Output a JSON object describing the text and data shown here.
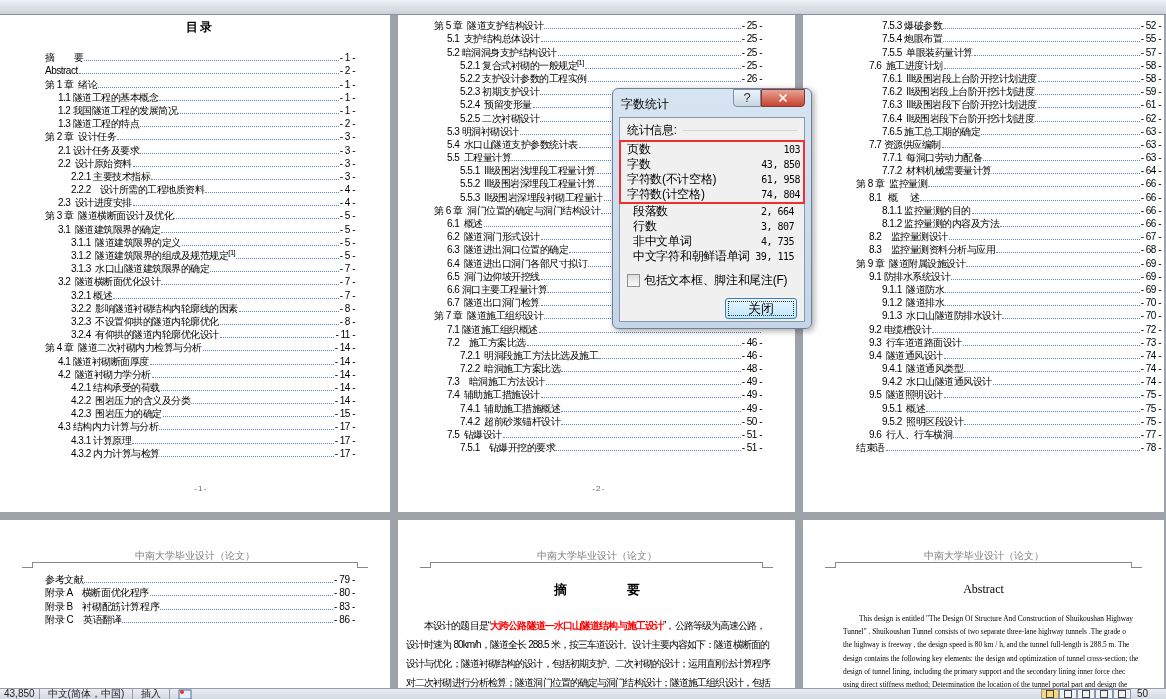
{
  "pages_top": [
    {
      "kind": "toc",
      "title": "目录",
      "footer": "- 1 -",
      "entries": [
        {
          "title": "摘　　要",
          "page": "- 1 -"
        },
        {
          "title": "Abstract",
          "page": "- 2 -"
        },
        {
          "title": "第 1 章  绪论",
          "page": "- 1 -",
          "children": [
            {
              "title": "1.1 隧道工程的基本概念",
              "page": "- 1 -"
            },
            {
              "title": "1.2 我国隧道工程的发展简况",
              "page": "- 1 -"
            },
            {
              "title": "1.3 隧道工程的特点",
              "page": "- 2 -"
            }
          ]
        },
        {
          "title": "第 2 章  设计任务",
          "page": "- 3 -",
          "children": [
            {
              "title": "2.1 设计任务及要求",
              "page": "- 3 -"
            },
            {
              "title": "2.2  设计原始资料",
              "page": "- 3 -",
              "children": [
                {
                  "title": "2.2.1 主要技术指标",
                  "page": "- 3 -"
                },
                {
                  "title": "2.2.2    设计所需的工程地质资料",
                  "page": "- 4 -"
                }
              ]
            },
            {
              "title": "2.3  设计进度安排",
              "page": "- 4 -"
            }
          ]
        },
        {
          "title": "第 3 章  隧道横断面设计及优化",
          "page": "- 5 -",
          "children": [
            {
              "title": "3.1  隧道建筑限界的确定",
              "page": "- 5 -",
              "children": [
                {
                  "title": "3.1.1  隧道建筑限界的定义",
                  "page": "- 5 -"
                },
                {
                  "title": "3.1.2  隧道建筑限界的组成及规范规定$^{[1]}$",
                  "page": "- 5 -"
                },
                {
                  "title": "3.1.3  水口山隧道建筑限界的确定",
                  "page": "- 7 -"
                }
              ]
            },
            {
              "title": "3.2  隧道横断面优化设计",
              "page": "- 7 -",
              "children": [
                {
                  "title": "3.2.1 概述",
                  "page": "- 7 -"
                },
                {
                  "title": "3.2.2  影响隧道衬砌结构内轮廓线的因素",
                  "page": "- 8 -"
                },
                {
                  "title": "3.2.3  不设置仰拱的隧道内轮廓优化",
                  "page": "- 8 -"
                },
                {
                  "title": "3.2.4  有仰拱的隧道内轮廓优化设计",
                  "page": "- 11 -"
                }
              ]
            }
          ]
        },
        {
          "title": "第 4 章  隧道二次衬砌内力检算与分析",
          "page": "- 14 -",
          "children": [
            {
              "title": "4.1 隧道衬砌断面厚度",
              "page": "- 14 -"
            },
            {
              "title": "4.2  隧道衬砌力学分析",
              "page": "- 14 -",
              "children": [
                {
                  "title": "4.2.1 结构承受的荷载",
                  "page": "- 14 -"
                },
                {
                  "title": "4.2.2  围岩压力的含义及分类",
                  "page": "- 14 -"
                },
                {
                  "title": "4.2.3  围岩压力的确定",
                  "page": "- 15 -"
                }
              ]
            },
            {
              "title": "4.3 结构内力计算与分析",
              "page": "- 17 -",
              "children": [
                {
                  "title": "4.3.1 计算原理",
                  "page": "- 17 -"
                },
                {
                  "title": "4.3.2 内力计算与检算",
                  "page": "- 17 -"
                }
              ]
            }
          ]
        }
      ]
    },
    {
      "kind": "toc",
      "footer": "- 2 -",
      "entries": [
        {
          "title": "第 5 章  隧道支护结构设计",
          "page": "- 25 -",
          "children": [
            {
              "title": "5.1  支护结构总体设计",
              "page": "- 25 -"
            },
            {
              "title": "5.2 暗洞洞身支护结构设计",
              "page": "- 25 -",
              "children": [
                {
                  "title": "5.2.1 复合式衬砌的一般规定$^{[1]}$",
                  "page": "- 25 -"
                },
                {
                  "title": "5.2.2 支护设计参数的工程实例",
                  "page": "- 26 -"
                },
                {
                  "title": "5.2.3 初期支护设计"
                },
                {
                  "title": "5.2.4  预留变形量"
                },
                {
                  "title": "5.2.5 二次衬砌设计"
                }
              ]
            },
            {
              "title": "5.3 明洞衬砌设计"
            },
            {
              "title": "5.4  水口山隧道支护参数统计表"
            },
            {
              "title": "5.5  工程量计算",
              "children": [
                {
                  "title": "5.5.1  III级围岩浅埋段工程量计算"
                },
                {
                  "title": "5.5.2  III级围岩深埋段工程量计算"
                },
                {
                  "title": "5.5.3  II级围岩深埋段衬砌工程量计"
                }
              ]
            }
          ]
        },
        {
          "title": "第 6 章  洞门位置的确定与洞门结构设计",
          "children": [
            {
              "title": "6.1  概述"
            },
            {
              "title": "6.2  隧道洞门形式设计"
            },
            {
              "title": "6.3  隧道进出洞口位置的确定"
            },
            {
              "title": "6.4  隧道进出口洞门各部尺寸拟订"
            },
            {
              "title": "6.5  洞门边仰坡开挖线"
            },
            {
              "title": "6.6 洞口主要工程量计算"
            },
            {
              "title": "6.7  隧道出口洞门检算"
            }
          ]
        },
        {
          "title": "第 7 章  隧道施工组织设计",
          "children": [
            {
              "title": "7.1 隧道施工组织概述"
            },
            {
              "title": "7.2    施工方案比选",
              "page": "- 46 -",
              "children": [
                {
                  "title": "7.2.1  明洞段施工方法比选及施工",
                  "page": "- 46 -"
                },
                {
                  "title": "7.2.2  暗洞施工方案比选",
                  "page": "- 48 -"
                }
              ]
            },
            {
              "title": "7.3    暗洞施工方法设计",
              "page": "- 49 -"
            },
            {
              "title": "7.4  辅助施工措施设计",
              "page": "- 49 -",
              "children": [
                {
                  "title": "7.4.1  辅助施工措施概述",
                  "page": "- 49 -"
                },
                {
                  "title": "7.4.2  超前砂浆锚杆设计",
                  "page": "- 50 -"
                }
              ]
            },
            {
              "title": "7.5  钻爆设计",
              "page": "- 51 -",
              "children": [
                {
                  "title": "7.5.1    钻爆开挖的要求",
                  "page": "- 51 -"
                }
              ]
            }
          ]
        }
      ]
    },
    {
      "kind": "toc",
      "entries": [
        {
          "children": [
            {
              "children": [
                {
                  "title": "7.5.3 爆破参数",
                  "page": "- 52 -"
                },
                {
                  "title": "7.5.4 炮眼布置",
                  "page": "- 55 -"
                },
                {
                  "title": "7.5.5  单眼装药量计算",
                  "page": "- 57 -"
                }
              ]
            },
            {
              "title": "7.6  施工进度计划",
              "page": "- 58 -",
              "children": [
                {
                  "title": "7.6.1  III级围岩段上台阶开挖计划进度",
                  "page": "- 58 -"
                },
                {
                  "title": "7.6.2  II级围岩段上台阶开挖计划进度",
                  "page": "- 59 -"
                },
                {
                  "title": "7.6.3  III级围岩段下台阶开挖计划进度",
                  "page": "- 61 -"
                },
                {
                  "title": "7.6.4  II级围岩段下台阶开挖计划进度",
                  "page": "- 62 -"
                },
                {
                  "title": "7.6.5 施工总工期的确定",
                  "page": "- 63 -"
                }
              ]
            },
            {
              "title": "7.7 资源供应编制",
              "page": "- 63 -",
              "children": [
                {
                  "title": "7.7.1  每洞口劳动力配备",
                  "page": "- 63 -"
                },
                {
                  "title": "7.7.2  材料机械需要量计算",
                  "page": "- 64 -"
                }
              ]
            }
          ]
        },
        {
          "title": "第 8 章  监控量测",
          "page": "- 66 -",
          "children": [
            {
              "title": "8.1   概　 述",
              "page": "- 66 -",
              "children": [
                {
                  "title": "8.1.1 监控量测的目的",
                  "page": "- 66 -"
                },
                {
                  "title": "8.1.2 监控量测的内容及方法",
                  "page": "- 66 -"
                }
              ]
            },
            {
              "title": "8.2    监控量测设计",
              "page": "- 67 -"
            },
            {
              "title": "8.3    监控量测资料分析与应用",
              "page": "- 68 -"
            }
          ]
        },
        {
          "title": "第 9 章  隧道附属设施设计",
          "page": "- 69 -",
          "children": [
            {
              "title": "9.1 防排水系统设计",
              "page": "- 69 -",
              "children": [
                {
                  "title": "9.1.1  隧道防水",
                  "page": "- 69 -"
                },
                {
                  "title": "9.1.2  隧道排水",
                  "page": "- 70 -"
                },
                {
                  "title": "9.1.3  水口山隧道防排水设计",
                  "page": "- 70 -"
                }
              ]
            },
            {
              "title": "9.2 电缆槽设计",
              "page": "- 72 -"
            },
            {
              "title": "9.3  行车道道路面设计",
              "page": "- 73 -"
            },
            {
              "title": "9.4  隧道通风设计",
              "page": "- 74 -",
              "children": [
                {
                  "title": "9.4.1  隧道通风类型",
                  "page": "- 74 -"
                },
                {
                  "title": "9.4.2  水口山隧道通风设计",
                  "page": "- 74 -"
                }
              ]
            },
            {
              "title": "9.5  隧道照明设计",
              "page": "- 75 -",
              "children": [
                {
                  "title": "9.5.1  概述",
                  "page": "- 75 -"
                },
                {
                  "title": "9.5.2  照明区段设计",
                  "page": "- 75 -"
                }
              ]
            },
            {
              "title": "9.6  行人、行车横洞",
              "page": "- 77 -"
            }
          ]
        },
        {
          "title": "结束语",
          "page": "- 78 -"
        }
      ]
    }
  ],
  "pages_bottom": [
    {
      "kind": "toc",
      "header": "中南大学毕业设计（论文）",
      "entries": [
        {
          "title": "参考文献",
          "page": "- 79 -"
        },
        {
          "title": "附录 A    横断面优化程序",
          "page": "- 80 -"
        },
        {
          "title": "附录 B    衬砌配筋计算程序",
          "page": "- 83 -"
        },
        {
          "title": "附录 C    英语翻译",
          "page": "- 86 -"
        }
      ]
    },
    {
      "kind": "chinese_text",
      "header": "中南大学毕业设计（论文）",
      "title": "摘 要",
      "lines": [
        "本设计的题目是“**大跨公路隧道—水口山隧道结构与施工设计**”，公路等级为高速公路，",
        "设计时速为 80km/h，隧道全长 288.5 米，按三车道设计。设计主要内容如下：隧道横断面的",
        "设计与优化；隧道衬砌结构的设计，包括初期支护、二次衬砌的设计；运用直刚法计算程序",
        "对二次衬砌进行分析检算；隧道洞门位置的确定与洞门结构设计；隧道施工组织设计，包括"
      ]
    },
    {
      "kind": "english_text",
      "header": "中南大学毕业设计（论文）",
      "title": "Abstract",
      "lines": [
        "This design is entitled \"The Design Of Structure And Construction of Shuikoushan Highway",
        "Tunnel\" . Shuikoushan Tunnel consists of two separate three-lane highway tunnels .The grade o",
        "the highway is freeway , the design speed is 80 km / h, and the tunnel full-length is 288.5 m. The",
        "design contains the following key elements: the design and optimization of tunnel cross-section; the",
        "design of tunnel lining, including the primary support and the secondary lining inner force chec",
        "using direct stiffness method; Determination the location of the tunnel portal part and design the"
      ]
    }
  ],
  "dialog": {
    "title": "字数统计",
    "help_button": "?",
    "group_label": "统计信息:",
    "stats": [
      {
        "label": "页数",
        "value": "103",
        "highlighted": true
      },
      {
        "label": "字数",
        "value": "43, 850",
        "highlighted": true
      },
      {
        "label": "字符数(不计空格)",
        "value": "61, 958",
        "highlighted": true
      },
      {
        "label": "字符数(计空格)",
        "value": "74, 804",
        "highlighted": true
      },
      {
        "label": "段落数",
        "value": "2, 664",
        "highlighted": false
      },
      {
        "label": "行数",
        "value": "3, 807",
        "highlighted": false
      },
      {
        "label": "非中文单词",
        "value": "4, 735",
        "highlighted": false
      },
      {
        "label": "中文字符和朝鲜语单词",
        "value": "39, 115",
        "highlighted": false
      }
    ],
    "checkbox": {
      "label": "包括文本框、脚注和尾注(F)",
      "checked": false
    },
    "close_button": "关闭"
  },
  "status_bar": {
    "word_count": "43,850",
    "language": "中文(简体，中国)",
    "mode": "插入",
    "zoom": "50",
    "view_buttons": [
      {
        "selected": true
      },
      {
        "selected": false
      },
      {
        "selected": false
      },
      {
        "selected": false
      },
      {
        "selected": false
      }
    ]
  }
}
